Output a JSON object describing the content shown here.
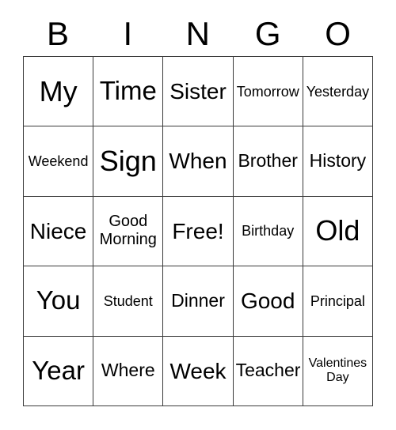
{
  "card": {
    "type": "bingo-card",
    "columns": 5,
    "rows": 5,
    "background_color": "#ffffff",
    "text_color": "#000000",
    "border_color": "#3a3a3a"
  },
  "header": {
    "letters": [
      "B",
      "I",
      "N",
      "G",
      "O"
    ]
  },
  "grid": {
    "rows": [
      [
        {
          "text": "My",
          "size": "xl"
        },
        {
          "text": "Time",
          "size": "lg"
        },
        {
          "text": "Sister",
          "size": "md"
        },
        {
          "text": "Tomorrow",
          "size": "xs"
        },
        {
          "text": "Yesterday",
          "size": "xs"
        }
      ],
      [
        {
          "text": "Weekend",
          "size": "xs"
        },
        {
          "text": "Sign",
          "size": "xl"
        },
        {
          "text": "When",
          "size": "md"
        },
        {
          "text": "Brother",
          "size": "sm"
        },
        {
          "text": "History",
          "size": "sm"
        }
      ],
      [
        {
          "text": "Niece",
          "size": "md"
        },
        {
          "text": "Good\nMorning",
          "size": "two"
        },
        {
          "text": "Free!",
          "size": "md"
        },
        {
          "text": "Birthday",
          "size": "xs"
        },
        {
          "text": "Old",
          "size": "xl"
        }
      ],
      [
        {
          "text": "You",
          "size": "lg"
        },
        {
          "text": "Student",
          "size": "xs"
        },
        {
          "text": "Dinner",
          "size": "sm"
        },
        {
          "text": "Good",
          "size": "md"
        },
        {
          "text": "Principal",
          "size": "xs"
        }
      ],
      [
        {
          "text": "Year",
          "size": "lg"
        },
        {
          "text": "Where",
          "size": "sm"
        },
        {
          "text": "Week",
          "size": "md"
        },
        {
          "text": "Teacher",
          "size": "sm"
        },
        {
          "text": "Valentines\nDay",
          "size": "xxs"
        }
      ]
    ]
  }
}
